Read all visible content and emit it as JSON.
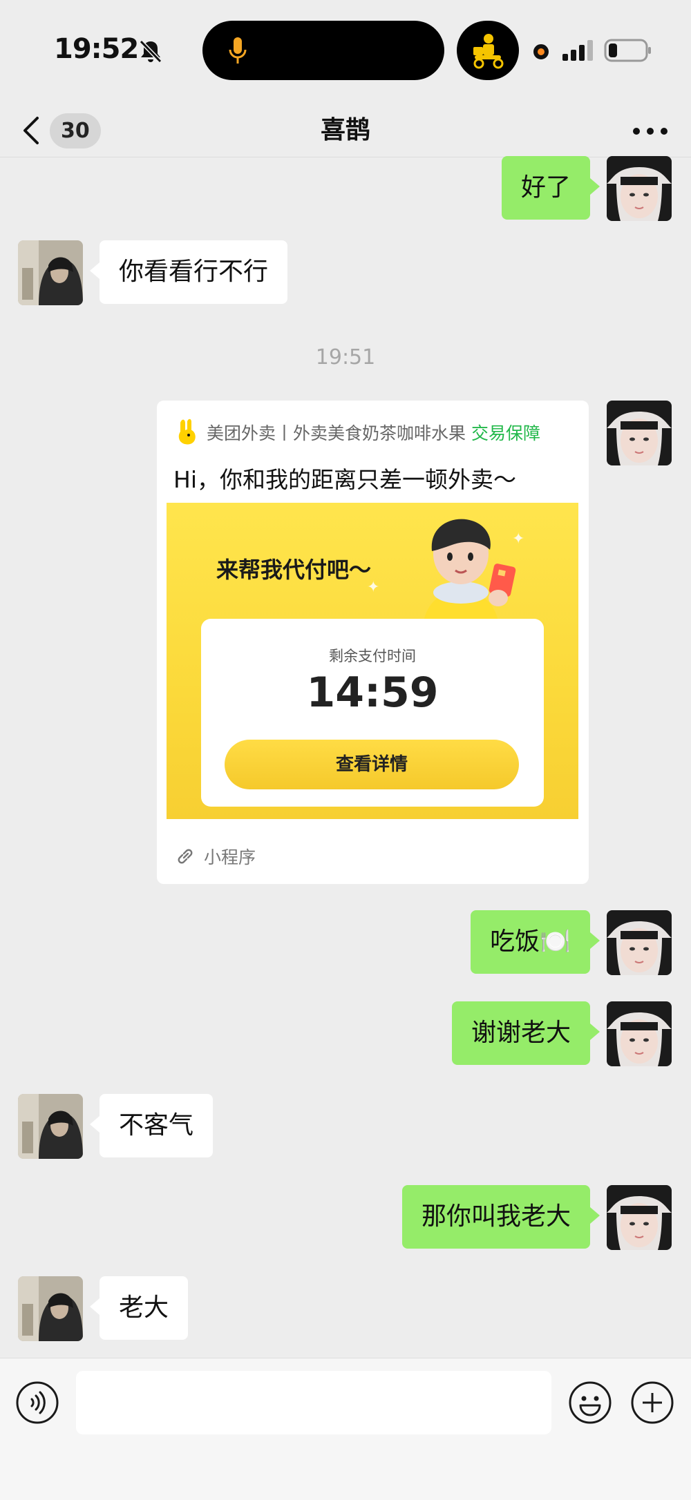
{
  "status_bar": {
    "time": "19:52",
    "icons": [
      "bell-slash-icon",
      "microphone-icon",
      "delivery-rider-icon",
      "recording-dot-icon",
      "signal-icon",
      "battery-icon"
    ]
  },
  "nav": {
    "unread_count": "30",
    "title": "喜鹊",
    "more_icon": "more-dots-icon"
  },
  "messages": [
    {
      "side": "right",
      "text": "好了"
    },
    {
      "side": "left",
      "text": "你看看行不行"
    },
    {
      "side": "right",
      "text": "吃饭🍽️"
    },
    {
      "side": "right",
      "text": "谢谢老大"
    },
    {
      "side": "left",
      "text": "不客气"
    },
    {
      "side": "right",
      "text": "那你叫我老大"
    },
    {
      "side": "left",
      "text": "老大"
    }
  ],
  "time_divider": "19:51",
  "mini_program_card": {
    "source": "美团外卖丨外卖美食奶茶咖啡水果",
    "guarantee": "交易保障",
    "text": "Hi，你和我的距离只差一顿外卖～",
    "promo": "来帮我代付吧～",
    "timer_label": "剩余支付时间",
    "timer_value": "14:59",
    "button": "查看详情",
    "footer": "小程序"
  },
  "input_bar": {
    "placeholder": "",
    "icons": [
      "voice-icon",
      "emoji-icon",
      "plus-icon"
    ]
  },
  "colors": {
    "background": "#ededed",
    "outgoing_bubble": "#95ec69",
    "incoming_bubble": "#ffffff",
    "guarantee_green": "#22b84a",
    "card_yellow": "#fbd93a"
  }
}
